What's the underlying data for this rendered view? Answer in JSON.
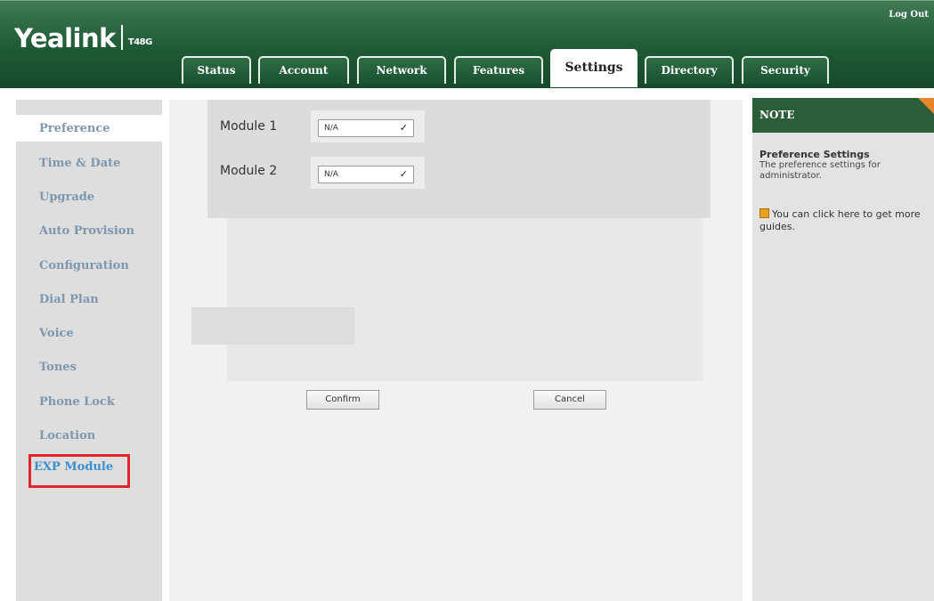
{
  "header": {
    "brand": "Yealink",
    "model": "T48G",
    "logout_label": "Log Out"
  },
  "tabs": [
    {
      "label": "Status"
    },
    {
      "label": "Account"
    },
    {
      "label": "Network"
    },
    {
      "label": "Features"
    },
    {
      "label": "Settings",
      "active": true
    },
    {
      "label": "Directory"
    },
    {
      "label": "Security"
    }
  ],
  "sidebar": {
    "items": [
      {
        "label": "Preference"
      },
      {
        "label": "Time & Date"
      },
      {
        "label": "Upgrade"
      },
      {
        "label": "Auto Provision"
      },
      {
        "label": "Configuration"
      },
      {
        "label": "Dial Plan"
      },
      {
        "label": "Voice"
      },
      {
        "label": "Tones"
      },
      {
        "label": "Phone Lock"
      },
      {
        "label": "Location"
      },
      {
        "label": "EXP Module",
        "active": true
      }
    ]
  },
  "form": {
    "module1_label": "Module 1",
    "module1_value": "N/A",
    "module2_label": "Module 2",
    "module2_value": "N/A",
    "confirm_label": "Confirm",
    "cancel_label": "Cancel"
  },
  "note": {
    "heading": "NOTE",
    "title": "Preference Settings",
    "text": "The preference settings for administrator.",
    "guide": "You can click here to get more guides."
  },
  "colors": {
    "header_green": "#1f5a36",
    "sidebar_link": "#7e97ad",
    "active_link": "#3a8fd0",
    "highlight_red": "#e0262c",
    "note_corner": "#e8862a"
  }
}
